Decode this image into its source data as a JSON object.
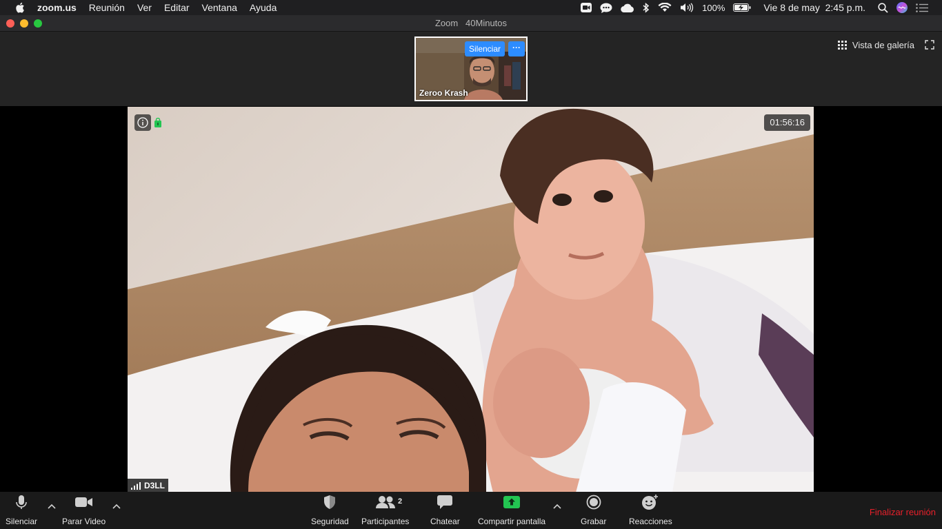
{
  "menubar": {
    "app_name": "zoom.us",
    "items": [
      "Reunión",
      "Ver",
      "Editar",
      "Ventana",
      "Ayuda"
    ],
    "battery": "100%",
    "datetime": "Vie 8 de may  2:45 p.m."
  },
  "window": {
    "title": "Zoom   40Minutos"
  },
  "thumbnail": {
    "mute_label": "Silenciar",
    "more_label": "···",
    "participant_name": "Zeroo Krash"
  },
  "view": {
    "gallery_label": "Vista de galería"
  },
  "main_video": {
    "timer": "01:56:16",
    "speaker_name": "D3LL"
  },
  "toolbar": {
    "mute_label": "Silenciar",
    "video_label": "Parar Video",
    "security_label": "Seguridad",
    "participants_label": "Participantes",
    "participants_count": "2",
    "chat_label": "Chatear",
    "share_label": "Compartir pantalla",
    "record_label": "Grabar",
    "reactions_label": "Reacciones",
    "end_label": "Finalizar reunión"
  },
  "colors": {
    "accent_blue": "#2d8cff",
    "share_green": "#23c552",
    "end_red": "#e8202a"
  }
}
